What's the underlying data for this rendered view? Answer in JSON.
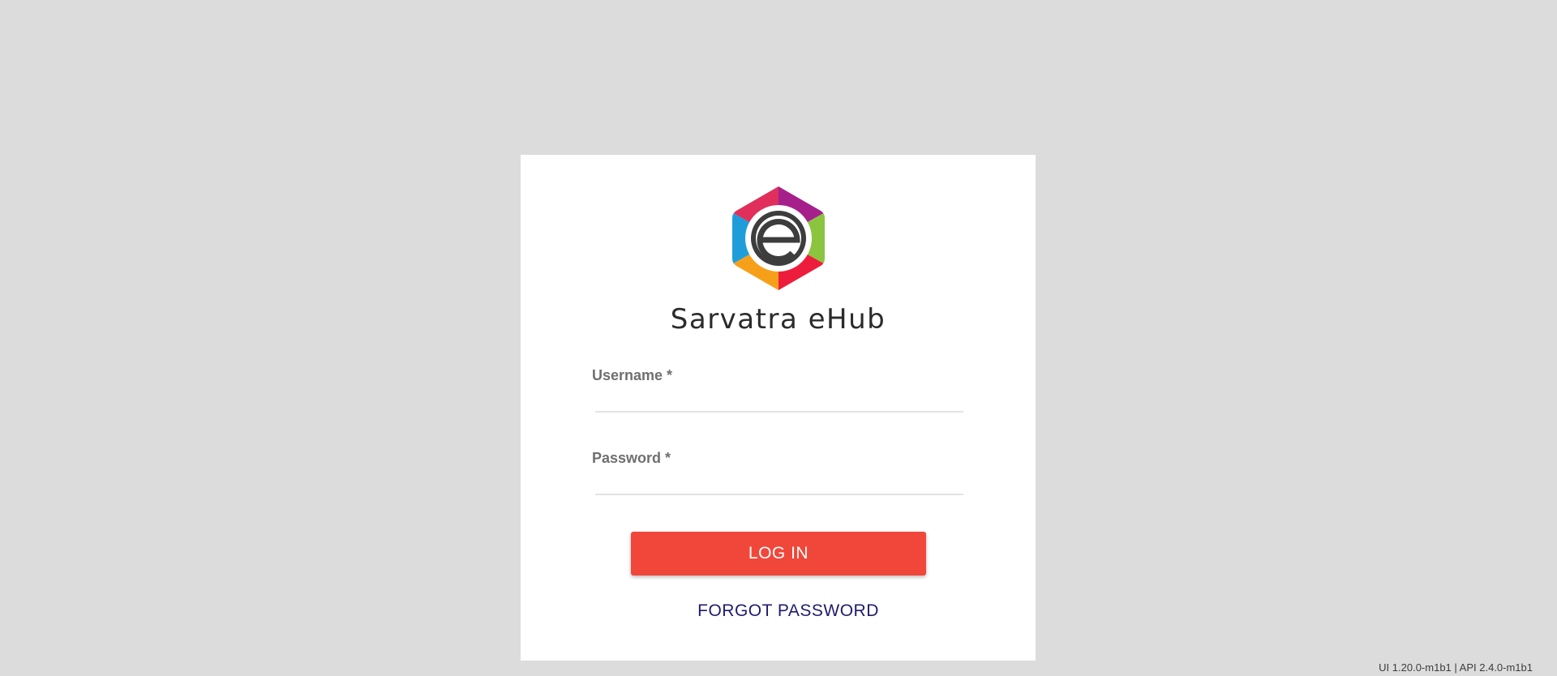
{
  "brand": {
    "app_name": "Sarvatra eHub",
    "logo_icon": "ehub-hexagon-logo",
    "logo_letter": "e",
    "logo_colors": [
      "#a6208c",
      "#8bc540",
      "#ee1c3c",
      "#f6a01a",
      "#1f9ddb",
      "#e02f5b"
    ]
  },
  "login_form": {
    "username": {
      "label": "Username *",
      "value": ""
    },
    "password": {
      "label": "Password *",
      "value": ""
    },
    "login_button": "LOG IN",
    "forgot_password": "FORGOT PASSWORD"
  },
  "footer": {
    "version": "UI 1.20.0-m1b1 | API 2.4.0-m1b1"
  },
  "colors": {
    "background": "#dcdcdc",
    "accent": "#f0473a",
    "link": "#1f1b6e"
  }
}
